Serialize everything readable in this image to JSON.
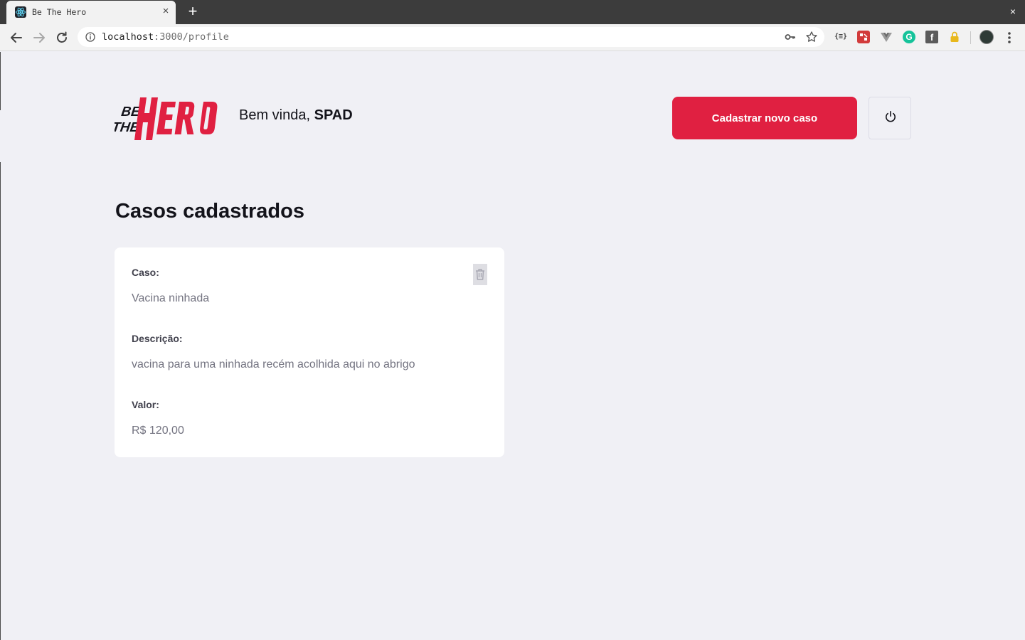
{
  "browser": {
    "tab_title": "Be The Hero",
    "tab_close": "×",
    "new_tab": "+",
    "window_close": "×",
    "url_host": "localhost",
    "url_path": ":3000/profile",
    "extensions": {
      "json_label": "{≡}",
      "grammarly_label": "G",
      "facebook_label": "f"
    }
  },
  "header": {
    "greeting_prefix": "Bem vinda, ",
    "ong_name": "SPAD",
    "new_case_button": "Cadastrar novo caso"
  },
  "main": {
    "section_title": "Casos cadastrados",
    "cases": [
      {
        "case_label": "Caso:",
        "case_value": "Vacina ninhada",
        "description_label": "Descrição:",
        "description_value": "vacina para uma ninhada recém acolhida aqui no abrigo",
        "value_label": "Valor:",
        "value_value": "R$ 120,00"
      }
    ]
  },
  "colors": {
    "brand_red": "#e02041",
    "background": "#f0f0f5",
    "card": "#ffffff",
    "label": "#41414d",
    "muted_text": "#737380"
  }
}
